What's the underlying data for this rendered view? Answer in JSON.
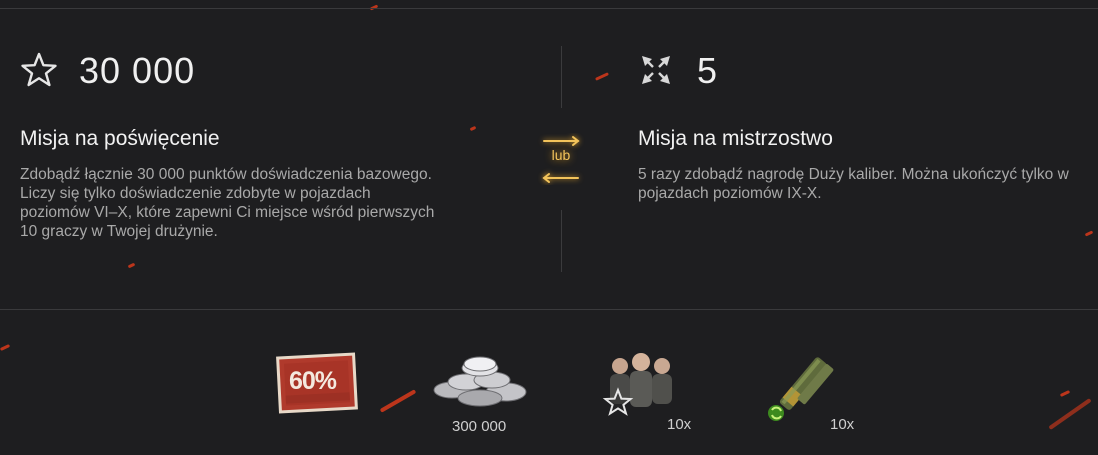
{
  "left_mission": {
    "icon": "star-outline-icon",
    "count": "30 000",
    "title": "Misja na poświęcenie",
    "description": "Zdobądź łącznie 30 000 punktów doświadczenia bazowego. Liczy się tylko doświadczenie zdobyte w pojazdach poziomów VI–X, które zapewni Ci miejsce wśród pierwszych 10 graczy w Twojej drużynie."
  },
  "separator": {
    "label": "lub",
    "icon": "swap-arrows-icon"
  },
  "right_mission": {
    "icon": "crossed-arrows-icon",
    "count": "5",
    "title": "Misja na mistrzostwo",
    "description": "5 razy zdobądź nagrodę Duży kaliber. Można ukończyć tylko w pojazdach poziomów IX-X."
  },
  "rewards": [
    {
      "icon": "discount-coupon-icon",
      "coupon_text": "60%",
      "label": ""
    },
    {
      "icon": "silver-coins-icon",
      "label": "300 000"
    },
    {
      "icon": "crew-icon",
      "label": "10x"
    },
    {
      "icon": "shell-ammo-icon",
      "label": "10x"
    }
  ],
  "colors": {
    "background": "#1e1e20",
    "accent_gold": "#f2c35b",
    "ember_red": "#d8391b",
    "coupon_red": "#b8392b"
  }
}
